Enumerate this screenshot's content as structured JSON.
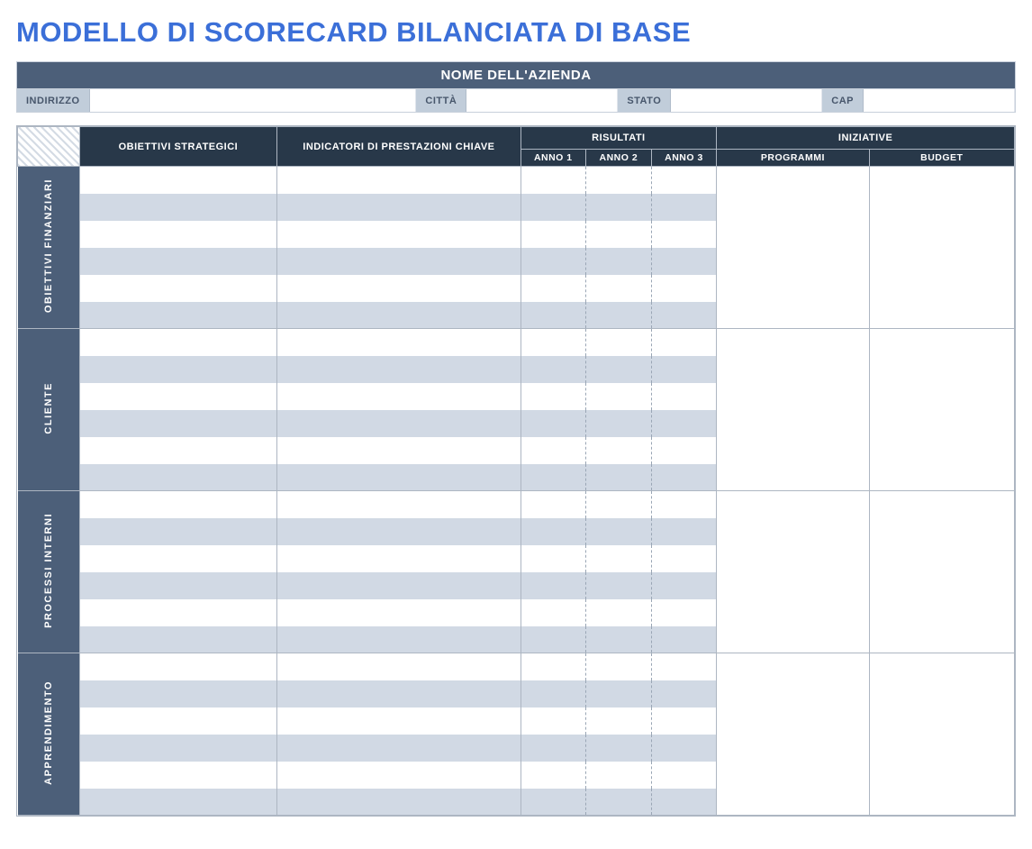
{
  "title": "MODELLO DI SCORECARD BILANCIATA DI BASE",
  "company_header": "NOME DELL'AZIENDA",
  "address": {
    "label_address": "INDIRIZZO",
    "value_address": "",
    "label_city": "CITTÀ",
    "value_city": "",
    "label_state": "STATO",
    "value_state": "",
    "label_zip": "CAP",
    "value_zip": ""
  },
  "headers": {
    "objectives": "OBIETTIVI STRATEGICI",
    "kpi": "INDICATORI DI PRESTAZIONI CHIAVE",
    "results": "RISULTATI",
    "year1": "ANNO 1",
    "year2": "ANNO 2",
    "year3": "ANNO 3",
    "initiatives": "INIZIATIVE",
    "programs": "PROGRAMMI",
    "budget": "BUDGET"
  },
  "sections": [
    {
      "label": "OBIETTIVI FINANZIARI",
      "rows": 6,
      "data": [
        {
          "objective": "",
          "kpi": "",
          "y1": "",
          "y2": "",
          "y3": ""
        },
        {
          "objective": "",
          "kpi": "",
          "y1": "",
          "y2": "",
          "y3": ""
        },
        {
          "objective": "",
          "kpi": "",
          "y1": "",
          "y2": "",
          "y3": ""
        },
        {
          "objective": "",
          "kpi": "",
          "y1": "",
          "y2": "",
          "y3": ""
        },
        {
          "objective": "",
          "kpi": "",
          "y1": "",
          "y2": "",
          "y3": ""
        },
        {
          "objective": "",
          "kpi": "",
          "y1": "",
          "y2": "",
          "y3": ""
        }
      ],
      "programs": "",
      "budget": ""
    },
    {
      "label": "CLIENTE",
      "rows": 6,
      "data": [
        {
          "objective": "",
          "kpi": "",
          "y1": "",
          "y2": "",
          "y3": ""
        },
        {
          "objective": "",
          "kpi": "",
          "y1": "",
          "y2": "",
          "y3": ""
        },
        {
          "objective": "",
          "kpi": "",
          "y1": "",
          "y2": "",
          "y3": ""
        },
        {
          "objective": "",
          "kpi": "",
          "y1": "",
          "y2": "",
          "y3": ""
        },
        {
          "objective": "",
          "kpi": "",
          "y1": "",
          "y2": "",
          "y3": ""
        },
        {
          "objective": "",
          "kpi": "",
          "y1": "",
          "y2": "",
          "y3": ""
        }
      ],
      "programs": "",
      "budget": ""
    },
    {
      "label": "PROCESSI INTERNI",
      "rows": 6,
      "data": [
        {
          "objective": "",
          "kpi": "",
          "y1": "",
          "y2": "",
          "y3": ""
        },
        {
          "objective": "",
          "kpi": "",
          "y1": "",
          "y2": "",
          "y3": ""
        },
        {
          "objective": "",
          "kpi": "",
          "y1": "",
          "y2": "",
          "y3": ""
        },
        {
          "objective": "",
          "kpi": "",
          "y1": "",
          "y2": "",
          "y3": ""
        },
        {
          "objective": "",
          "kpi": "",
          "y1": "",
          "y2": "",
          "y3": ""
        },
        {
          "objective": "",
          "kpi": "",
          "y1": "",
          "y2": "",
          "y3": ""
        }
      ],
      "programs": "",
      "budget": ""
    },
    {
      "label": "APPRENDIMENTO",
      "rows": 6,
      "data": [
        {
          "objective": "",
          "kpi": "",
          "y1": "",
          "y2": "",
          "y3": ""
        },
        {
          "objective": "",
          "kpi": "",
          "y1": "",
          "y2": "",
          "y3": ""
        },
        {
          "objective": "",
          "kpi": "",
          "y1": "",
          "y2": "",
          "y3": ""
        },
        {
          "objective": "",
          "kpi": "",
          "y1": "",
          "y2": "",
          "y3": ""
        },
        {
          "objective": "",
          "kpi": "",
          "y1": "",
          "y2": "",
          "y3": ""
        },
        {
          "objective": "",
          "kpi": "",
          "y1": "",
          "y2": "",
          "y3": ""
        }
      ],
      "programs": "",
      "budget": ""
    }
  ]
}
